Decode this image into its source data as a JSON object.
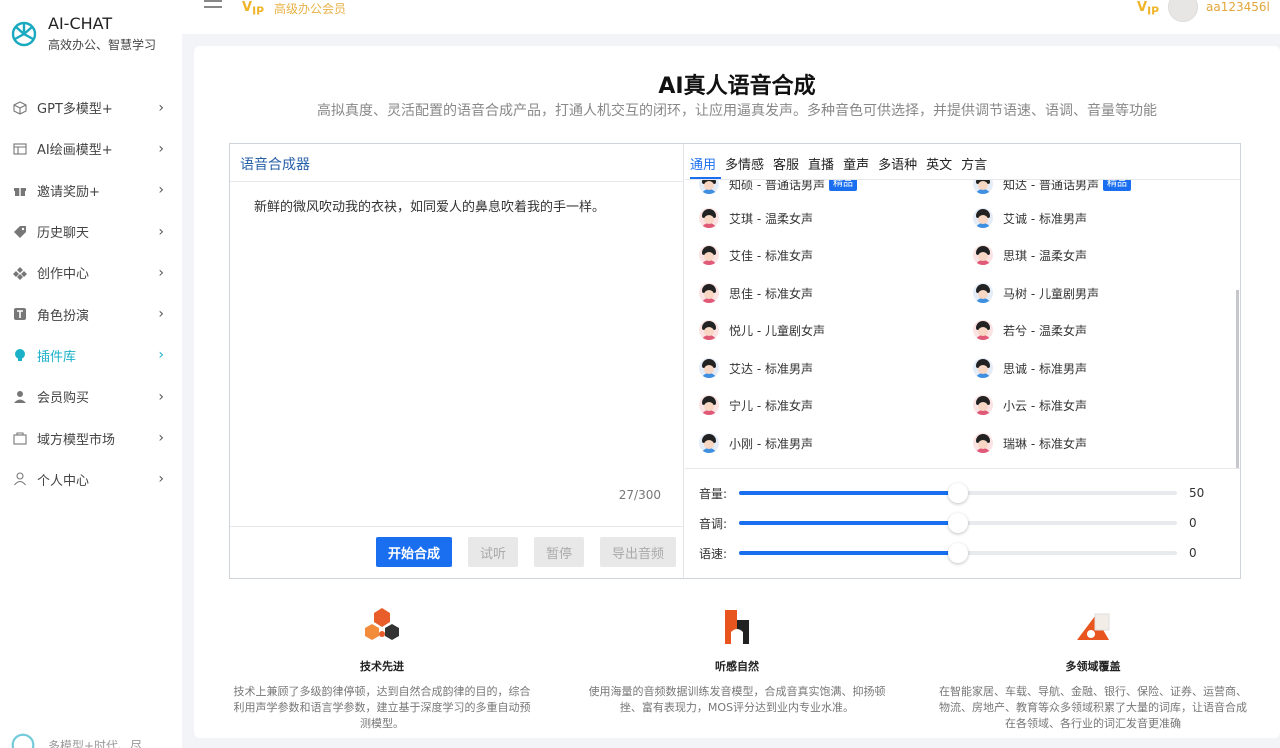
{
  "brand": {
    "title": "AI-CHAT",
    "subtitle": "高效办公、智慧学习"
  },
  "header": {
    "vip_text": "高级办公会员",
    "username": "aa123456l"
  },
  "menu": [
    {
      "label": "GPT多模型+",
      "icon": "cube-icon"
    },
    {
      "label": "AI绘画模型+",
      "icon": "palette-icon"
    },
    {
      "label": "邀请奖励+",
      "icon": "gift-icon"
    },
    {
      "label": "历史聊天",
      "icon": "tag-icon"
    },
    {
      "label": "创作中心",
      "icon": "grid-icon"
    },
    {
      "label": "角色扮演",
      "icon": "text-icon"
    },
    {
      "label": "插件库",
      "icon": "bulb-icon"
    },
    {
      "label": "会员购买",
      "icon": "user-icon"
    },
    {
      "label": "域方模型市场",
      "icon": "bag-icon"
    },
    {
      "label": "个人中心",
      "icon": "person-icon"
    }
  ],
  "sidebar_footer": "多模型+时代、尽",
  "page": {
    "title": "AI真人语音合成",
    "subtitle": "高拟真度、灵活配置的语音合成产品，打通人机交互的闭环，让应用逼真发声。多种音色可供选择，并提供调节语速、语调、音量等功能"
  },
  "synth": {
    "header": "语音合成器",
    "text": "新鲜的微风吹动我的衣袂，如同爱人的鼻息吹着我的手一样。",
    "counter": "27/300",
    "buttons": {
      "start": "开始合成",
      "listen": "试听",
      "pause": "暂停",
      "export": "导出音频"
    }
  },
  "tabs": [
    "通用",
    "多情感",
    "客服",
    "直播",
    "童声",
    "多语种",
    "英文",
    "方言"
  ],
  "voices": [
    {
      "name": "知硕 - 普通话男声",
      "gender": "m",
      "tag": "精品"
    },
    {
      "name": "知达 - 普通话男声",
      "gender": "m",
      "tag": "精品"
    },
    {
      "name": "艾琪 - 温柔女声",
      "gender": "f"
    },
    {
      "name": "艾诚 - 标准男声",
      "gender": "m"
    },
    {
      "name": "艾佳 - 标准女声",
      "gender": "f"
    },
    {
      "name": "思琪 - 温柔女声",
      "gender": "f"
    },
    {
      "name": "思佳 - 标准女声",
      "gender": "f"
    },
    {
      "name": "马树 - 儿童剧男声",
      "gender": "m"
    },
    {
      "name": "悦儿 - 儿童剧女声",
      "gender": "f"
    },
    {
      "name": "若兮 - 温柔女声",
      "gender": "f"
    },
    {
      "name": "艾达 - 标准男声",
      "gender": "m"
    },
    {
      "name": "思诚 - 标准男声",
      "gender": "m"
    },
    {
      "name": "宁儿 - 标准女声",
      "gender": "f"
    },
    {
      "name": "小云 - 标准女声",
      "gender": "f"
    },
    {
      "name": "小刚 - 标准男声",
      "gender": "m"
    },
    {
      "name": "瑞琳 - 标准女声",
      "gender": "f"
    }
  ],
  "sliders": [
    {
      "label": "音量:",
      "value": "50",
      "fraction": 0.5
    },
    {
      "label": "音调:",
      "value": "0",
      "fraction": 0.5
    },
    {
      "label": "语速:",
      "value": "0",
      "fraction": 0.5
    }
  ],
  "features": [
    {
      "title": "技术先进",
      "desc": "技术上兼顾了多级韵律停顿，达到自然合成韵律的目的，综合利用声学参数和语言学参数，建立基于深度学习的多重自动预测模型。"
    },
    {
      "title": "听感自然",
      "desc": "使用海量的音频数据训练发音模型，合成音真实饱满、抑扬顿挫、富有表现力，MOS评分达到业内专业水准。"
    },
    {
      "title": "多领域覆盖",
      "desc": "在智能家居、车载、导航、金融、银行、保险、证券、运营商、物流、房地产、教育等众多领域积累了大量的词库，让语音合成在各领域、各行业的词汇发音更准确"
    }
  ],
  "colors": {
    "primary": "#1a6ff0",
    "active_menu": "#1ab0c8",
    "vip": "#f0b429"
  }
}
